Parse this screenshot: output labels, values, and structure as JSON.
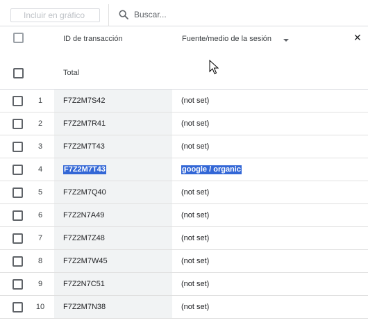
{
  "toolbar": {
    "chart_button_label": "Incluir en gráfico",
    "search_placeholder": "Buscar..."
  },
  "table": {
    "columns": {
      "transaction_id": "ID de transacción",
      "session_source_medium": "Fuente/medio de la sesión"
    },
    "total_label": "Total",
    "rows": [
      {
        "index": "1",
        "transaction_id": "F7Z2M7S42",
        "source_medium": "(not set)"
      },
      {
        "index": "2",
        "transaction_id": "F7Z2M7R41",
        "source_medium": "(not set)"
      },
      {
        "index": "3",
        "transaction_id": "F7Z2M7T43",
        "source_medium": "(not set)"
      },
      {
        "index": "4",
        "transaction_id": "F7Z2M7T43",
        "source_medium": "google / organic",
        "text_selected": true
      },
      {
        "index": "5",
        "transaction_id": "F7Z2M7Q40",
        "source_medium": "(not set)"
      },
      {
        "index": "6",
        "transaction_id": "F7Z2N7A49",
        "source_medium": "(not set)"
      },
      {
        "index": "7",
        "transaction_id": "F7Z2M7Z48",
        "source_medium": "(not set)"
      },
      {
        "index": "8",
        "transaction_id": "F7Z2M7W45",
        "source_medium": "(not set)"
      },
      {
        "index": "9",
        "transaction_id": "F7Z2N7C51",
        "source_medium": "(not set)"
      },
      {
        "index": "10",
        "transaction_id": "F7Z2M7N38",
        "source_medium": "(not set)"
      }
    ]
  },
  "colors": {
    "selection": "#3367d6",
    "id_column_bg": "#f1f3f4",
    "border": "#dadce0"
  }
}
